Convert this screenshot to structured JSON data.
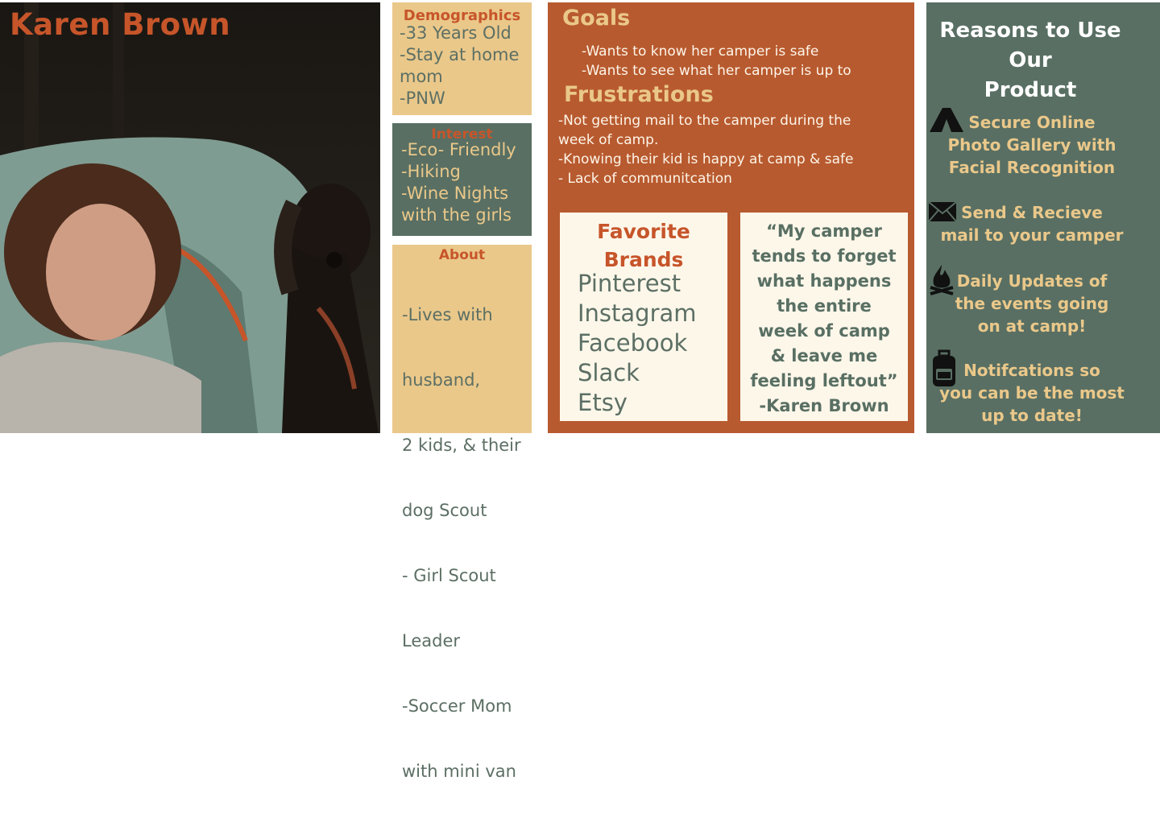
{
  "persona": {
    "name": "Karen Brown"
  },
  "demographics": {
    "title": "Demographics",
    "lines": [
      "-33 Years Old",
      "-Stay at home",
      "mom",
      "-PNW"
    ]
  },
  "interest": {
    "title": "Interest",
    "lines": [
      "-Eco- Friendly",
      "-Hiking",
      "-Wine Nights",
      "with the girls"
    ]
  },
  "about": {
    "title": "About",
    "lines": [
      "-Lives with",
      " husband,",
      "2 kids, & their",
      "dog Scout",
      "- Girl Scout",
      " Leader",
      "-Soccer Mom",
      "with mini van"
    ]
  },
  "goals": {
    "title": "Goals",
    "lines": [
      "-Wants to know her camper is safe",
      "-Wants to see what her camper is up to"
    ]
  },
  "frustrations": {
    "title": "Frustrations",
    "lines": [
      "-Not getting mail to the camper during the",
      "week of camp.",
      "-Knowing their kid is happy at camp & safe",
      "- Lack of communitcation"
    ]
  },
  "brands": {
    "title_lines": [
      "Favorite",
      "Brands"
    ],
    "items": [
      "Pinterest",
      "Instagram",
      "Facebook",
      "Slack",
      "Etsy"
    ]
  },
  "quote": {
    "lines": [
      "“My camper",
      "tends to forget",
      "what happens",
      "the entire",
      "week of camp",
      "& leave me",
      "feeling leftout”"
    ],
    "author": "-Karen Brown"
  },
  "reasons": {
    "title_lines": [
      "Reasons to Use",
      "Our",
      "Product"
    ],
    "items": [
      {
        "icon": "tent-icon",
        "lines": [
          "Secure Online",
          "Photo Gallery with",
          "Facial Recognition"
        ]
      },
      {
        "icon": "envelope-icon",
        "lines": [
          "Send & Recieve",
          "mail to your camper"
        ]
      },
      {
        "icon": "campfire-icon",
        "lines": [
          "Daily Updates of",
          "the events going",
          "on at camp!"
        ]
      },
      {
        "icon": "backpack-icon",
        "lines": [
          "Notifcations so",
          "you can be the most",
          "up to date!"
        ]
      }
    ]
  },
  "colors": {
    "rust": "#b85a2f",
    "orange_text": "#c7552a",
    "sage": "#596f63",
    "tan": "#eac88a",
    "cream": "#fdf7ea"
  }
}
